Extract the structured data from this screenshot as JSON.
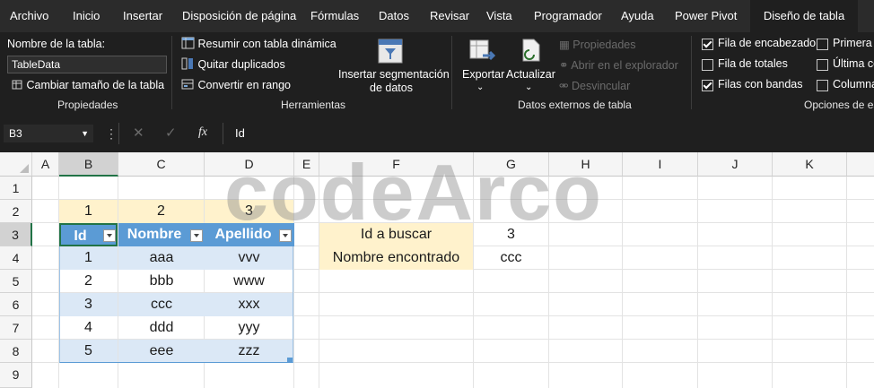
{
  "tabs": [
    "Archivo",
    "Inicio",
    "Insertar",
    "Disposición de página",
    "Fórmulas",
    "Datos",
    "Revisar",
    "Vista",
    "Programador",
    "Ayuda",
    "Power Pivot",
    "Diseño de tabla"
  ],
  "ribbon": {
    "propiedades": {
      "table_name_label": "Nombre de la tabla:",
      "table_name_value": "TableData",
      "resize": "Cambiar tamaño de la tabla",
      "group": "Propiedades"
    },
    "herramientas": {
      "pivot": "Resumir con tabla dinámica",
      "dups": "Quitar duplicados",
      "convert": "Convertir en rango",
      "slicer_line1": "Insertar segmentación",
      "slicer_line2": "de datos",
      "group": "Herramientas"
    },
    "externos": {
      "export": "Exportar",
      "refresh": "Actualizar",
      "props": "Propiedades",
      "open_browser": "Abrir en el explorador",
      "unlink": "Desvincular",
      "group": "Datos externos de tabla"
    },
    "estilos": {
      "header_row": "Fila de encabezado",
      "totals_row": "Fila de totales",
      "banded_rows": "Filas con bandas",
      "first_col": "Primera co",
      "last_col": "Última co",
      "banded_cols": "Columna",
      "group": "Opciones de es",
      "header_row_checked": true,
      "totals_row_checked": false,
      "banded_rows_checked": true,
      "first_col_checked": false,
      "last_col_checked": false,
      "banded_cols_checked": false
    }
  },
  "formula_bar": {
    "cell_ref": "B3",
    "value": "Id",
    "fx": "fx"
  },
  "columns": [
    "A",
    "B",
    "C",
    "D",
    "E",
    "F",
    "G",
    "H",
    "I",
    "J",
    "K"
  ],
  "rows": [
    "1",
    "2",
    "3",
    "4",
    "5",
    "6",
    "7",
    "8",
    "9"
  ],
  "sheet": {
    "row2": [
      "1",
      "2",
      "3"
    ],
    "table_headers": [
      "Id",
      "Nombre",
      "Apellido"
    ],
    "table_rows": [
      [
        "1",
        "aaa",
        "vvv"
      ],
      [
        "2",
        "bbb",
        "www"
      ],
      [
        "3",
        "ccc",
        "xxx"
      ],
      [
        "4",
        "ddd",
        "yyy"
      ],
      [
        "5",
        "eee",
        "zzz"
      ]
    ],
    "lookup": {
      "label_id": "Id a buscar",
      "label_name": "Nombre encontrado",
      "id_value": "3",
      "name_value": "ccc"
    }
  },
  "watermark": "codeArco",
  "colors": {
    "table_header": "#5b9bd5",
    "band": "#dbe8f6",
    "cream": "#fff2cc",
    "ribbon_bg": "#1f1f1f"
  }
}
